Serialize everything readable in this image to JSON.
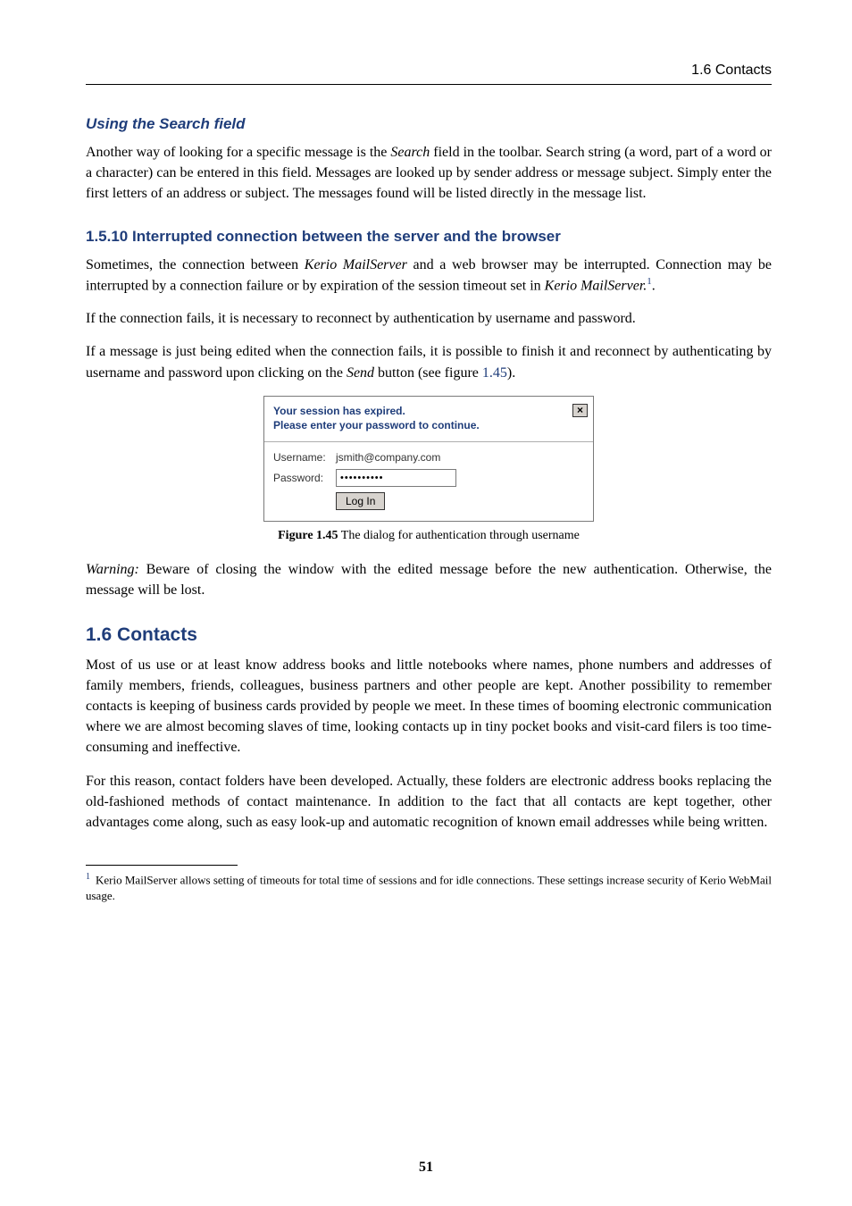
{
  "running_head": "1.6 Contacts",
  "section_search": {
    "title": "Using the Search field",
    "p1_a": "Another way of looking for a specific message is the ",
    "p1_em": "Search",
    "p1_b": " field in the toolbar. Search string (a word, part of a word or a character) can be entered in this field. Messages are looked up by sender address or message subject. Simply enter the first letters of an address or subject. The messages found will be listed directly in the message list."
  },
  "section_interrupted": {
    "title": "1.5.10  Interrupted connection between the server and the browser",
    "p1_a": "Sometimes, the connection between ",
    "p1_em1": "Kerio MailServer",
    "p1_b": " and a web browser may be interrupted. Connection may be interrupted by a connection failure or by expiration of the session timeout set in ",
    "p1_em2": "Kerio MailServer.",
    "p1_sup": "1",
    "p1_c": ".",
    "p2": "If the connection fails, it is necessary to reconnect by authentication by username and password.",
    "p3_a": "If a message is just being edited when the connection fails, it is possible to finish it and reconnect by authenticating by username and password upon clicking on the ",
    "p3_em": "Send",
    "p3_b": " button (see figure ",
    "p3_link": "1.45",
    "p3_c": ")."
  },
  "dialog": {
    "title_l1": "Your session has expired.",
    "title_l2": "Please enter your password to continue.",
    "close": "×",
    "username_label": "Username:",
    "username_value": "jsmith@company.com",
    "password_label": "Password:",
    "password_value": "••••••••••",
    "login_label": "Log In"
  },
  "caption": {
    "bold": "Figure 1.45",
    "rest": "   The dialog for authentication through username"
  },
  "warning": {
    "em": "Warning:",
    "text": " Beware of closing the window with the edited message before the new authentication. Otherwise, the message will be lost."
  },
  "section_contacts": {
    "title": "1.6  Contacts",
    "p1": "Most of us use or at least know address books and little notebooks where names, phone numbers and addresses of family members, friends, colleagues, business partners and other people are kept. Another possibility to remember contacts is keeping of business cards provided by people we meet. In these times of booming electronic communication where we are almost becoming slaves of time, looking contacts up in tiny pocket books and visit-card filers is too time-consuming and ineffective.",
    "p2": "For this reason, contact folders have been developed. Actually, these folders are electronic address books replacing the old-fashioned methods of contact maintenance. In addition to the fact that all contacts are kept together, other advantages come along, such as easy look-up and automatic recognition of known email addresses while being written."
  },
  "footnote": {
    "num": "1",
    "text": "Kerio MailServer allows setting of timeouts for total time of sessions and for idle connections. These settings increase security of Kerio WebMail usage."
  },
  "page_number": "51"
}
